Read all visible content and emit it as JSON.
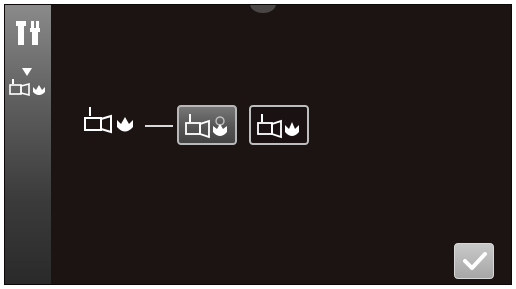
{
  "screen": {
    "background_color": "#1c1413",
    "accent_color": "#ffffff"
  },
  "sidebar": {
    "icons": [
      "tools-icon",
      "down-arrow-icon",
      "camera-flash-mode-icon"
    ]
  },
  "setting_row": {
    "label_icon": "camera-flash-mode-icon",
    "options": [
      {
        "icon": "camera-flash-dimmed-icon",
        "selected": true
      },
      {
        "icon": "camera-flash-on-icon",
        "selected": false
      }
    ]
  },
  "confirm": {
    "icon": "checkmark-icon"
  }
}
